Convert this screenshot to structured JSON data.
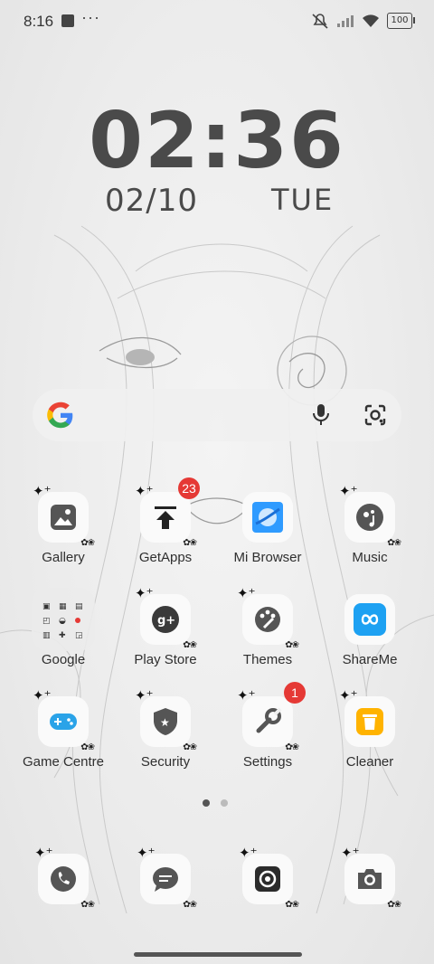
{
  "status_bar": {
    "time": "8:16",
    "overflow": "···",
    "battery": "100"
  },
  "clock": {
    "time": "02:36",
    "date": "02/10",
    "day": "TUE"
  },
  "apps": [
    {
      "label": "Gallery"
    },
    {
      "label": "GetApps",
      "badge": "23"
    },
    {
      "label": "Mi Browser"
    },
    {
      "label": "Music"
    },
    {
      "label": "Google"
    },
    {
      "label": "Play Store"
    },
    {
      "label": "Themes"
    },
    {
      "label": "ShareMe"
    },
    {
      "label": "Game Centre"
    },
    {
      "label": "Security"
    },
    {
      "label": "Settings",
      "badge": "1"
    },
    {
      "label": "Cleaner"
    }
  ],
  "dock": [
    "phone-icon",
    "messages-icon",
    "chrome-icon",
    "camera-icon"
  ],
  "page_indicator": {
    "pages": 2,
    "current": 1
  }
}
